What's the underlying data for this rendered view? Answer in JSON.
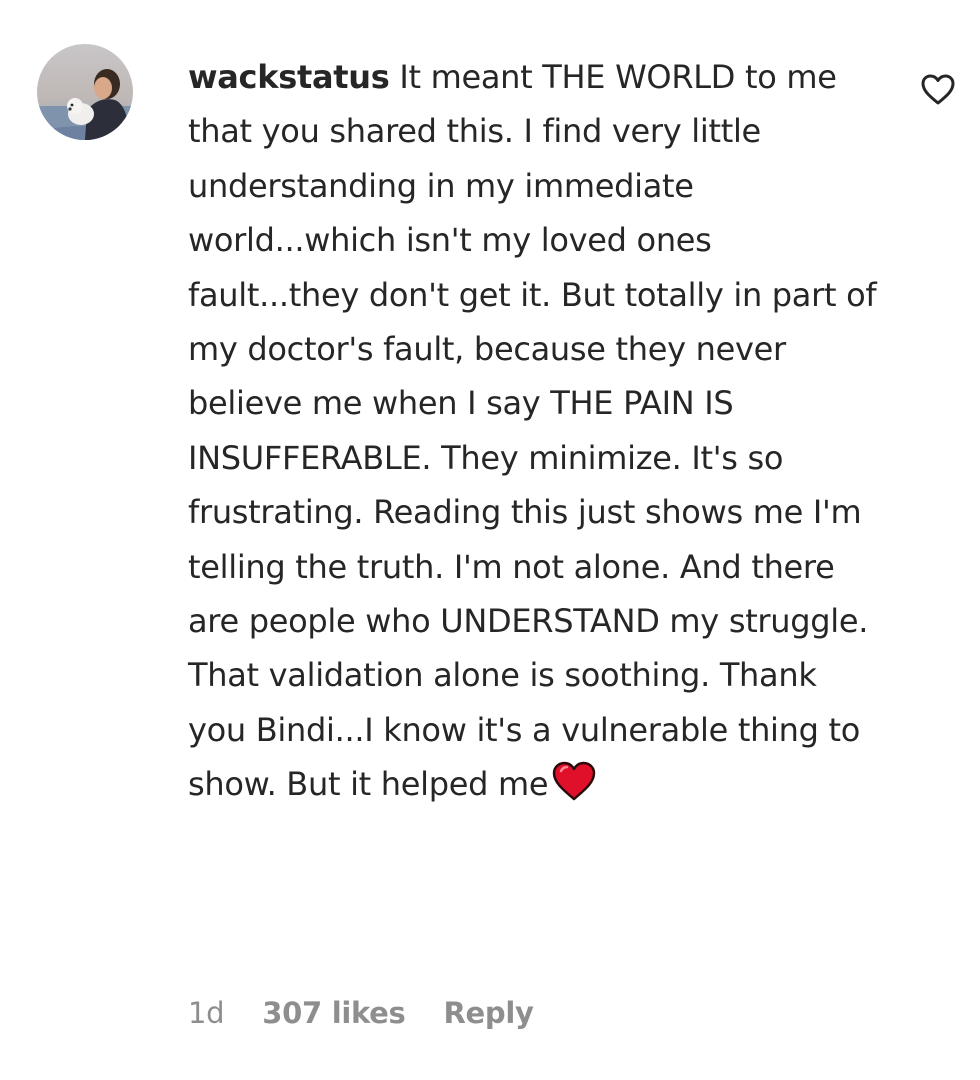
{
  "comment": {
    "username": "wackstatus",
    "text": "It meant THE WORLD to me that you shared this. I find very little understanding in my immediate world...which isn't my loved ones fault...they don't get it. But totally in part of my doctor's fault, because they never believe me when I say THE PAIN IS INSUFFERABLE. They minimize. It's so frustrating. Reading this just shows me I'm telling the truth. I'm not alone. And there are people who UNDERSTAND my struggle. That validation alone is soothing. Thank you Bindi...I know it's a vulnerable thing to show. But it helped me",
    "emoji": "red-heart-emoji",
    "time": "1d",
    "likes": "307 likes",
    "reply_label": "Reply"
  },
  "icons": {
    "like": "heart-outline-icon",
    "avatar": "avatar"
  },
  "colors": {
    "text": "#262626",
    "meta": "#8e8e8e",
    "emoji_heart": "#e0102a"
  }
}
